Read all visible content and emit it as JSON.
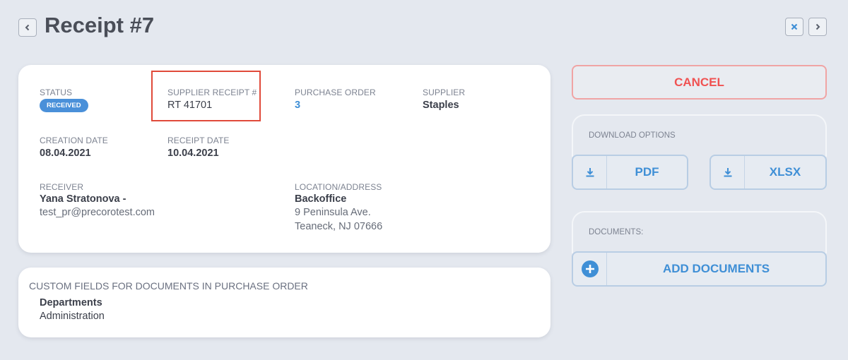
{
  "header": {
    "title": "Receipt #7",
    "back_icon": "chevron-left-icon",
    "close_icon": "close-icon",
    "next_icon": "chevron-right-icon"
  },
  "details": {
    "status": {
      "label": "STATUS",
      "value": "RECEIVED"
    },
    "supplier_receipt": {
      "label": "SUPPLIER RECEIPT #",
      "value": "RT 41701"
    },
    "purchase_order": {
      "label": "PURCHASE ORDER",
      "value": "3"
    },
    "supplier": {
      "label": "SUPPLIER",
      "value": "Staples"
    },
    "creation_date": {
      "label": "CREATION DATE",
      "value": "08.04.2021"
    },
    "receipt_date": {
      "label": "RECEIPT DATE",
      "value": "10.04.2021"
    },
    "receiver": {
      "label": "RECEIVER",
      "name": "Yana Stratonova -",
      "email": "test_pr@precorotest.com"
    },
    "location": {
      "label": "LOCATION/ADDRESS",
      "name": "Backoffice",
      "line1": "9 Peninsula Ave.",
      "line2": "Teaneck, NJ 07666"
    }
  },
  "custom_fields": {
    "title": "CUSTOM FIELDS FOR DOCUMENTS IN PURCHASE ORDER",
    "field_name": "Departments",
    "field_value": "Administration"
  },
  "actions": {
    "cancel_label": "CANCEL",
    "download_title": "DOWNLOAD OPTIONS",
    "pdf_label": "PDF",
    "xlsx_label": "XLSX",
    "documents_title": "DOCUMENTS:",
    "add_documents_label": "ADD DOCUMENTS"
  },
  "colors": {
    "accent": "#3f8fd6",
    "cancel": "#f05252",
    "highlight": "#e04a3a",
    "badge": "#4a90d9"
  }
}
